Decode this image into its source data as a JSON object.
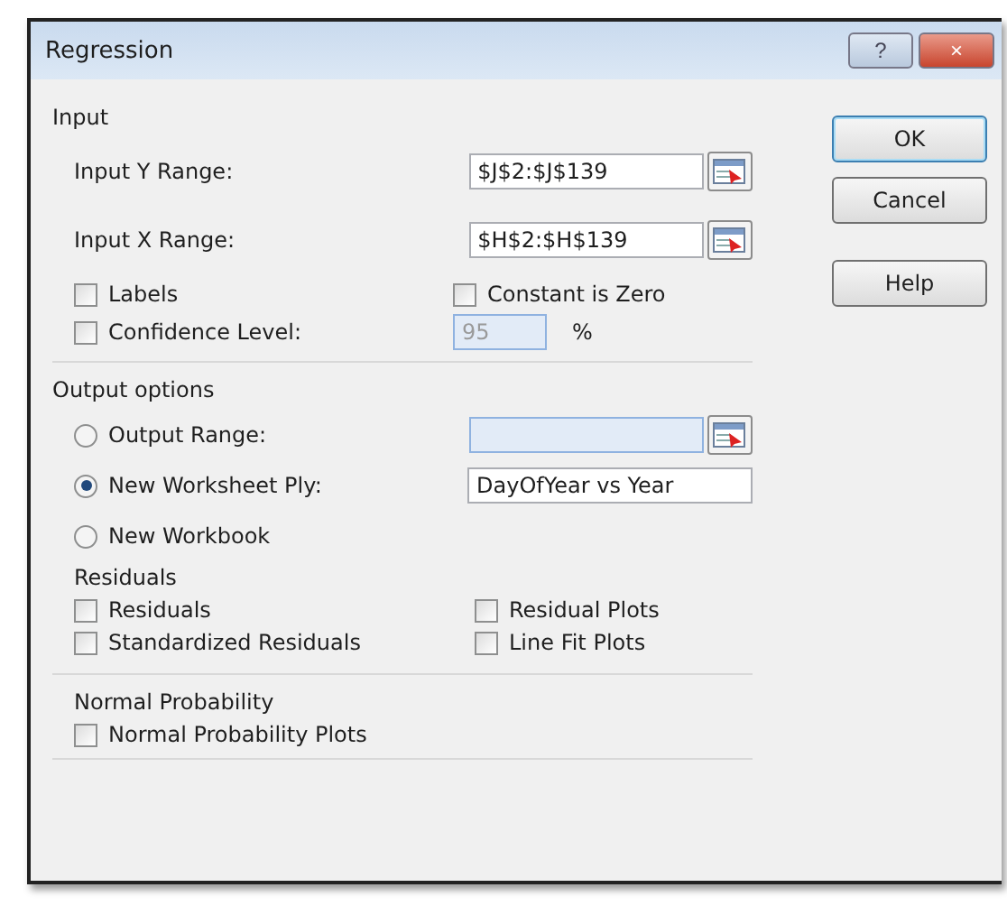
{
  "window": {
    "title": "Regression",
    "title_buttons": [
      {
        "kind": "help",
        "label": "?"
      },
      {
        "kind": "close",
        "label": "×"
      }
    ]
  },
  "input": {
    "heading": "Input",
    "ranges": [
      {
        "label": "Input Y Range:",
        "value": "$J$2:$J$139"
      },
      {
        "label": "Input X Range:",
        "value": "$H$2:$H$139"
      }
    ],
    "labels": {
      "label": "Labels",
      "checked": false
    },
    "constant_zero": {
      "label": "Constant is Zero",
      "checked": false
    },
    "confidence": {
      "label": "Confidence Level:",
      "checked": false,
      "value": "95",
      "unit": "%",
      "disabled": true
    }
  },
  "output_options": {
    "heading": "Output options",
    "choices": [
      {
        "label": "Output Range:",
        "selected": false,
        "field": {
          "disabled": true
        }
      },
      {
        "label": "New Worksheet Ply:",
        "selected": true,
        "field": {
          "value": "DayOfYear vs Year",
          "disabled": false
        }
      },
      {
        "label": "New Workbook",
        "selected": false
      }
    ]
  },
  "residuals": {
    "heading": "Residuals",
    "options": [
      {
        "label": "Residuals",
        "checked": false
      },
      {
        "label": "Residual Plots",
        "checked": false
      },
      {
        "label": "Standardized Residuals",
        "checked": false
      },
      {
        "label": "Line Fit Plots",
        "checked": false
      }
    ]
  },
  "normal_probability": {
    "heading": "Normal Probability",
    "options": [
      {
        "label": "Normal Probability Plots",
        "checked": false
      }
    ]
  },
  "buttons": [
    {
      "label": "OK",
      "default": true
    },
    {
      "label": "Cancel",
      "default": false
    },
    {
      "label": "Help",
      "default": false
    }
  ]
}
